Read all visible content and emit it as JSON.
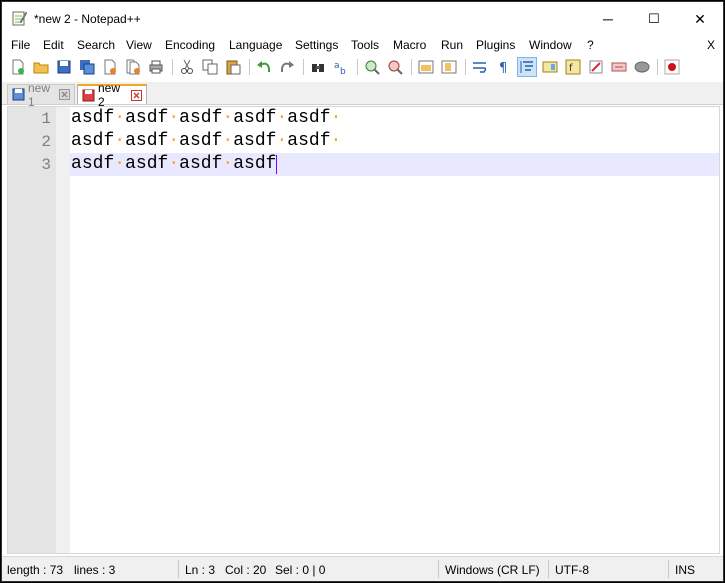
{
  "window": {
    "title": "*new 2 - Notepad++"
  },
  "window_controls": {
    "minimize": "─",
    "maximize": "☐",
    "close": "✕"
  },
  "menu": {
    "items": [
      "File",
      "Edit",
      "Search",
      "View",
      "Encoding",
      "Language",
      "Settings",
      "Tools",
      "Macro",
      "Run",
      "Plugins",
      "Window",
      "?"
    ],
    "close": "X"
  },
  "toolbar": {
    "icons": [
      "new-file-icon",
      "open-file-icon",
      "save-icon",
      "save-all-icon",
      "close-icon",
      "close-all-icon",
      "print-icon",
      "cut-icon",
      "copy-icon",
      "paste-icon",
      "undo-icon",
      "redo-icon",
      "find-icon",
      "replace-icon",
      "zoom-in-icon",
      "zoom-out-icon",
      "sync-vertical-icon",
      "sync-horizontal-icon",
      "word-wrap-icon",
      "show-all-characters-icon",
      "indent-guide-icon",
      "document-map-icon",
      "function-list-icon",
      "folder-workspace-icon",
      "monitoring-icon",
      "macro-record-icon"
    ]
  },
  "tabs": [
    {
      "label": "new 1",
      "active": false
    },
    {
      "label": "new 2",
      "active": true
    }
  ],
  "editor": {
    "lines": [
      {
        "number": "1",
        "text": "asdf asdf asdf asdf asdf "
      },
      {
        "number": "2",
        "text": "asdf asdf asdf asdf asdf "
      },
      {
        "number": "3",
        "text": "asdf asdf asdf asdf"
      }
    ],
    "current_line": 3
  },
  "status": {
    "length": "length : 73",
    "lines": "lines : 3",
    "ln": "Ln : 3",
    "col": "Col : 20",
    "sel": "Sel : 0 | 0",
    "eol": "Windows (CR LF)",
    "encoding": "UTF-8",
    "mode": "INS"
  },
  "colors": {
    "accent_tab": "#f5a623",
    "caret": "#8000ff",
    "current_line": "#e8e8ff",
    "whitespace_dot": "#f5a623"
  }
}
